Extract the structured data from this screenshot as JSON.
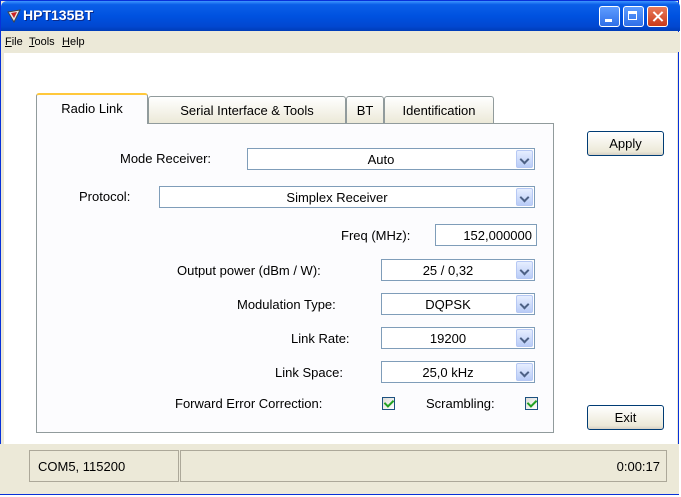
{
  "window": {
    "title": "HPT135BT"
  },
  "menu": {
    "items": [
      "File",
      "Tools",
      "Help"
    ]
  },
  "tabs": [
    {
      "label": "Radio Link"
    },
    {
      "label": "Serial Interface & Tools"
    },
    {
      "label": "BT"
    },
    {
      "label": "Identification"
    }
  ],
  "form": {
    "mode_receiver_label": "Mode Receiver:",
    "mode_receiver_value": "Auto",
    "protocol_label": "Protocol:",
    "protocol_value": "Simplex Receiver",
    "freq_label": "Freq (MHz):",
    "freq_value": "152,000000",
    "output_power_label": "Output power (dBm / W):",
    "output_power_value": "25 / 0,32",
    "modulation_label": "Modulation Type:",
    "modulation_value": "DQPSK",
    "link_rate_label": "Link Rate:",
    "link_rate_value": "19200",
    "link_space_label": "Link Space:",
    "link_space_value": "25,0 kHz",
    "fec_label": "Forward Error Correction:",
    "fec_checked": true,
    "scrambling_label": "Scrambling:",
    "scrambling_checked": true
  },
  "buttons": {
    "apply": "Apply",
    "exit": "Exit"
  },
  "status": {
    "port": "COM5, 115200",
    "time": "0:00:17"
  },
  "colors": {
    "title_bar": "#0052e0",
    "tab_highlight": "#ffc83c",
    "window_bg": "#ece9d8"
  }
}
